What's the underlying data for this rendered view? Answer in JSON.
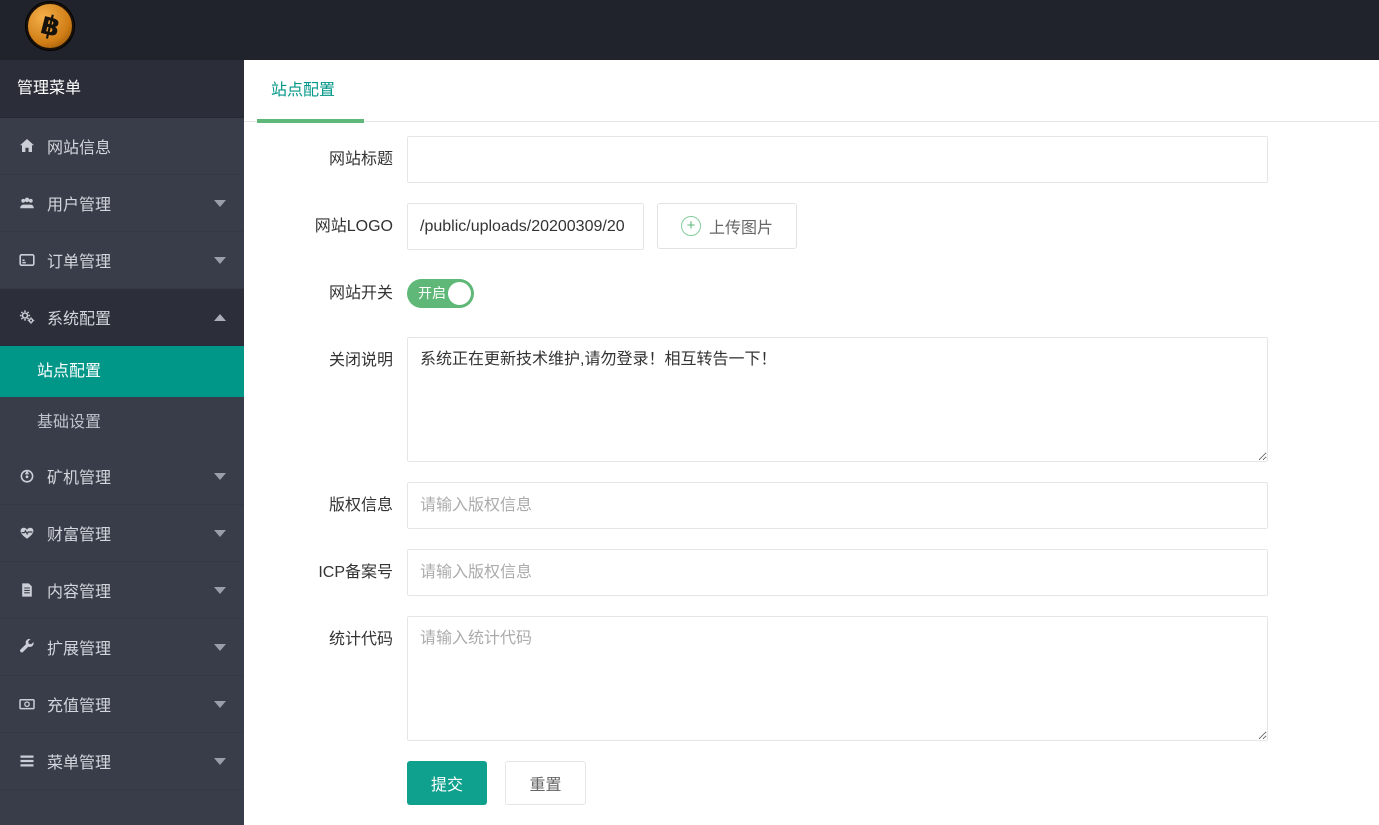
{
  "colors": {
    "accent_teal": "#009688",
    "button_teal": "#10A08E",
    "switch_green": "#5FB878",
    "tab_underline_green": "#5FB878",
    "sidebar_bg": "#393D49",
    "sidebar_active_bg": "#009688",
    "topbar_bg": "#20232B"
  },
  "topbar": {
    "logo_icon": "bitcoin-coin-icon",
    "logo_glyph": "฿"
  },
  "sidebar": {
    "header": "管理菜单",
    "items": [
      {
        "label": "网站信息",
        "icon": "home-icon",
        "has_children": false
      },
      {
        "label": "用户管理",
        "icon": "users-icon",
        "has_children": true
      },
      {
        "label": "订单管理",
        "icon": "order-card-icon",
        "has_children": true
      },
      {
        "label": "系统配置",
        "icon": "gears-icon",
        "has_children": true,
        "expanded": true
      },
      {
        "label": "矿机管理",
        "icon": "miner-icon",
        "has_children": true
      },
      {
        "label": "财富管理",
        "icon": "heartbeat-icon",
        "has_children": true
      },
      {
        "label": "内容管理",
        "icon": "document-icon",
        "has_children": true
      },
      {
        "label": "扩展管理",
        "icon": "wrench-icon",
        "has_children": true
      },
      {
        "label": "充值管理",
        "icon": "money-icon",
        "has_children": true
      },
      {
        "label": "菜单管理",
        "icon": "bars-icon",
        "has_children": true
      }
    ],
    "submenu": [
      {
        "label": "站点配置",
        "active": true
      },
      {
        "label": "基础设置",
        "active": false
      }
    ]
  },
  "main": {
    "active_tab": "站点配置",
    "form": {
      "site_title": {
        "label": "网站标题",
        "value": ""
      },
      "site_logo": {
        "label": "网站LOGO",
        "value": "/public/uploads/20200309/20",
        "upload_button": "上传图片",
        "upload_icon": "circle-plus-icon"
      },
      "site_switch": {
        "label": "网站开关",
        "state": "on",
        "state_label": "开启"
      },
      "close_note": {
        "label": "关闭说明",
        "value": "系统正在更新技术维护,请勿登录！相互转告一下！"
      },
      "copyright": {
        "label": "版权信息",
        "placeholder": "请输入版权信息"
      },
      "icp": {
        "label": "ICP备案号",
        "placeholder": "请输入版权信息"
      },
      "stats_code": {
        "label": "统计代码",
        "placeholder": "请输入统计代码"
      }
    },
    "buttons": {
      "submit": "提交",
      "reset": "重置"
    }
  }
}
